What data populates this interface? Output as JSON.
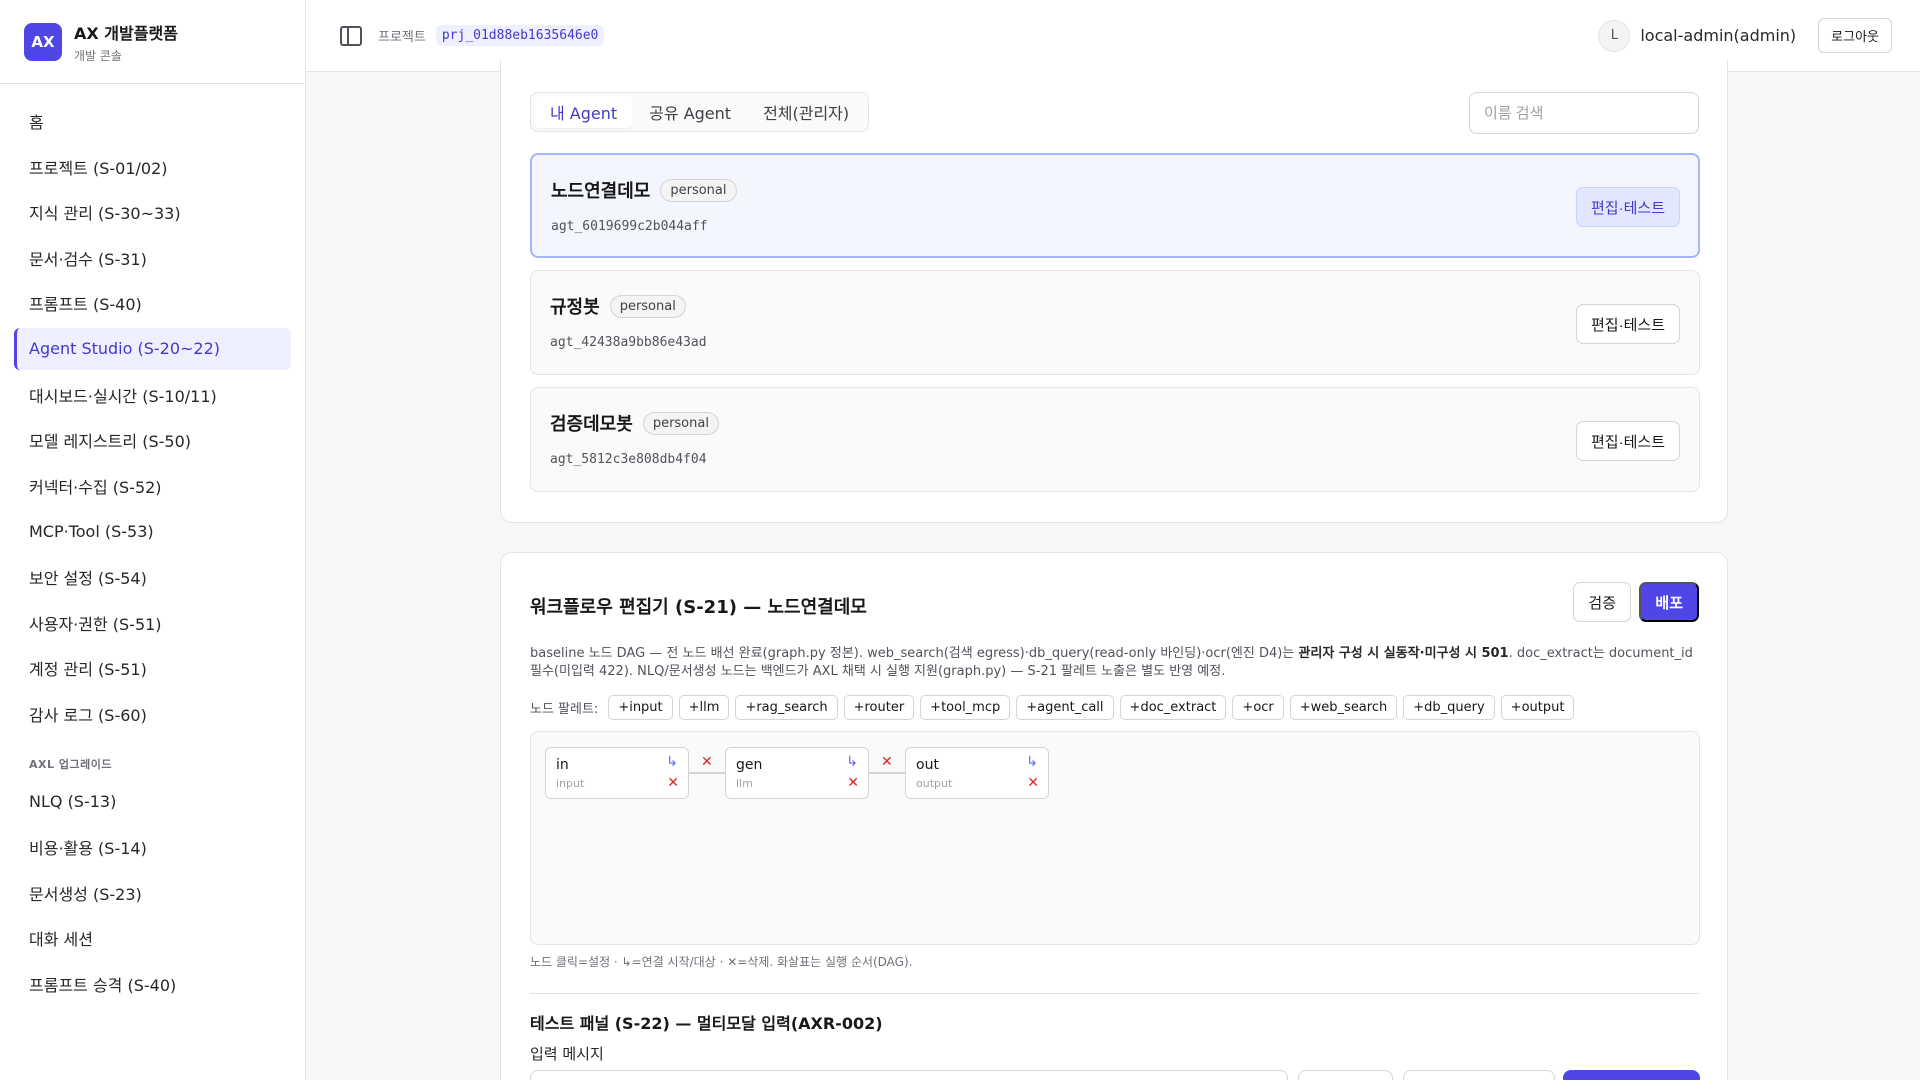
{
  "brand": {
    "logo": "AX",
    "title": "AX 개발플랫폼",
    "subtitle": "개발 콘솔"
  },
  "sidebar": {
    "items": [
      {
        "label": "홈"
      },
      {
        "label": "프로젝트 (S-01/02)"
      },
      {
        "label": "지식 관리 (S-30~33)"
      },
      {
        "label": "문서·검수 (S-31)"
      },
      {
        "label": "프롬프트 (S-40)"
      },
      {
        "label": "Agent Studio (S-20~22)",
        "active": true
      },
      {
        "label": "대시보드·실시간 (S-10/11)"
      },
      {
        "label": "모델 레지스트리 (S-50)"
      },
      {
        "label": "커넥터·수집 (S-52)"
      },
      {
        "label": "MCP·Tool (S-53)"
      },
      {
        "label": "보안 설정 (S-54)"
      },
      {
        "label": "사용자·권한 (S-51)"
      },
      {
        "label": "계정 관리 (S-51)"
      },
      {
        "label": "감사 로그 (S-60)"
      }
    ],
    "section_label": "AXL 업그레이드",
    "section_items": [
      {
        "label": "NLQ (S-13)"
      },
      {
        "label": "비용·활용 (S-14)"
      },
      {
        "label": "문서생성 (S-23)"
      },
      {
        "label": "대화 세션"
      },
      {
        "label": "프롬프트 승격 (S-40)"
      }
    ]
  },
  "topbar": {
    "panel_icon": "sidebar-toggle-icon",
    "project_label": "프로젝트",
    "project_id": "prj_01d88eb1635646e0",
    "avatar_initial": "L",
    "user": "local-admin(admin)",
    "logout": "로그아웃"
  },
  "agents": {
    "tabs": [
      {
        "label": "내 Agent",
        "active": true
      },
      {
        "label": "공유 Agent"
      },
      {
        "label": "전체(관리자)"
      }
    ],
    "search_placeholder": "이름 검색",
    "list": [
      {
        "name": "노드연결데모",
        "badge": "personal",
        "id": "agt_6019699c2b044aff",
        "action": "편집·테스트",
        "selected": true
      },
      {
        "name": "규정봇",
        "badge": "personal",
        "id": "agt_42438a9bb86e43ad",
        "action": "편집·테스트"
      },
      {
        "name": "검증데모봇",
        "badge": "personal",
        "id": "agt_5812c3e808db4f04",
        "action": "편집·테스트"
      }
    ]
  },
  "workflow": {
    "title": "워크플로우 편집기 (S-21) — 노드연결데모",
    "verify_label": "검증",
    "deploy_label": "배포",
    "desc_part1": "baseline 노드 DAG — 전 노드 배선 완료(graph.py 정본). web_search(검색 egress)·db_query(read-only 바인딩)·ocr(엔진 D4)는 ",
    "desc_bold": "관리자 구성 시 실동작·미구성 시 501",
    "desc_part2": ". doc_extract는 document_id 필수(미입력 422). NLQ/문서생성 노드는 백엔드가 AXL 채택 시 실행 지원(graph.py) — S-21 팔레트 노출은 별도 반영 예정.",
    "palette_label": "노드 팔레트:",
    "palette": [
      "+input",
      "+llm",
      "+rag_search",
      "+router",
      "+tool_mcp",
      "+agent_call",
      "+doc_extract",
      "+ocr",
      "+web_search",
      "+db_query",
      "+output"
    ],
    "nodes": [
      {
        "name": "in",
        "type": "input"
      },
      {
        "name": "gen",
        "type": "llm"
      },
      {
        "name": "out",
        "type": "output"
      }
    ],
    "link_glyph": "↳",
    "delete_glyph": "✕",
    "hint": "노드 클릭=설정 · ↳=연결 시작/대상 · ✕=삭제. 화살표는 실행 순서(DAG).",
    "test_title": "테스트 패널 (S-22) — 멀티모달 입력(AXR-002)",
    "input_label": "입력 메시지"
  },
  "colors": {
    "accent": "#4f46e5",
    "danger": "#dc2626"
  }
}
